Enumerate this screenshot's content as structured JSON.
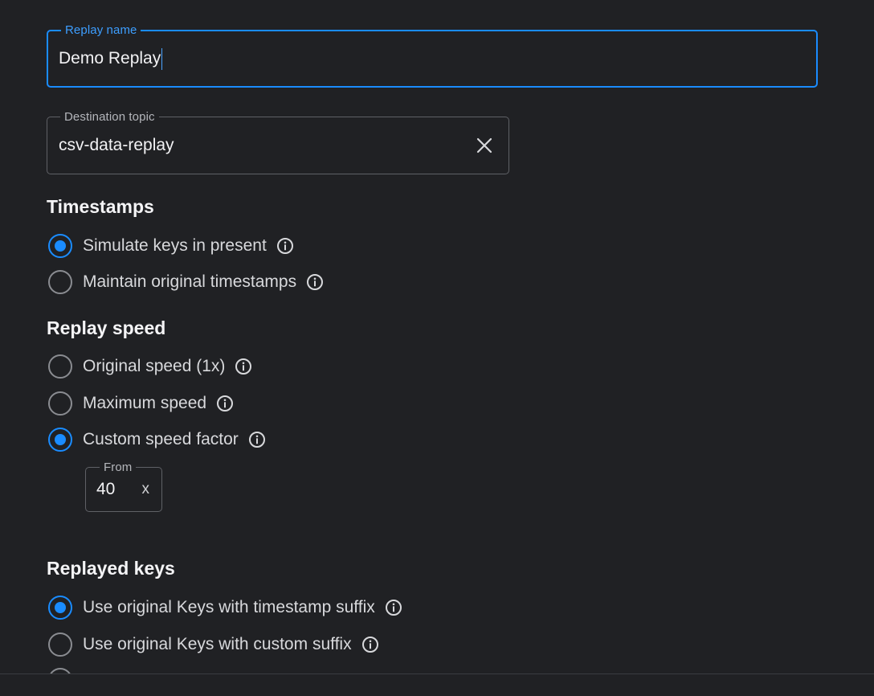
{
  "replay_name": {
    "label": "Replay name",
    "value": "Demo Replay"
  },
  "destination_topic": {
    "label": "Destination topic",
    "value": "csv-data-replay"
  },
  "timestamps": {
    "title": "Timestamps",
    "options": [
      {
        "label": "Simulate keys in present",
        "selected": true
      },
      {
        "label": "Maintain original timestamps",
        "selected": false
      }
    ]
  },
  "replay_speed": {
    "title": "Replay speed",
    "options": [
      {
        "label": "Original speed (1x)",
        "selected": false
      },
      {
        "label": "Maximum speed",
        "selected": false
      },
      {
        "label": "Custom speed factor",
        "selected": true
      }
    ],
    "factor": {
      "label": "From",
      "value": "40",
      "suffix": "x"
    }
  },
  "replayed_keys": {
    "title": "Replayed keys",
    "options": [
      {
        "label": "Use original Keys with timestamp suffix",
        "selected": true
      },
      {
        "label": "Use original Keys with custom suffix",
        "selected": false
      }
    ]
  },
  "colors": {
    "background": "#202124",
    "accent": "#1a8cff"
  },
  "icons": {
    "clear": "close-icon",
    "info": "info-icon"
  }
}
